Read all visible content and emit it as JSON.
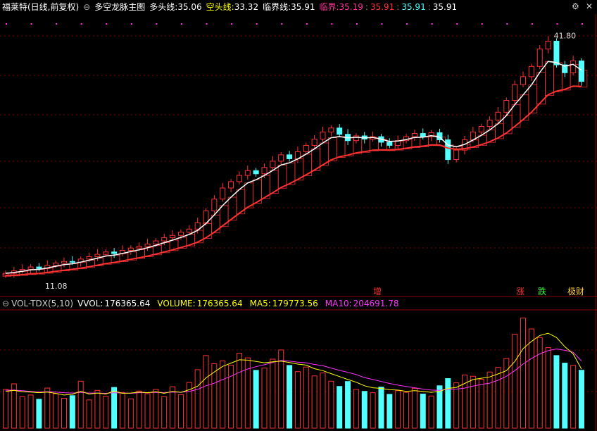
{
  "main_header": {
    "stock": "福莱特(日线,前复权)",
    "indicator_icon": "circle-minus-icon",
    "indicator": "多空龙脉主图",
    "bull_label": "多头线:",
    "bull_value": "35.06",
    "bear_label": "空头线:",
    "bear_value": "33.32",
    "crit_label": "临界线:",
    "crit_value": "35.91",
    "crit2_label": "临界:",
    "crit2_values": [
      "35.19",
      "35.91",
      "35.91",
      "35.91"
    ]
  },
  "vol_header": {
    "indicator_icon": "circle-minus-icon",
    "name": "VOL-TDX(5,10)",
    "vvol_label": "VVOL:",
    "vvol_value": "176365.64",
    "volume_label": "VOLUME:",
    "volume_value": "176365.64",
    "ma5_label": "MA5:",
    "ma5_value": "179773.56",
    "ma10_label": "MA10:",
    "ma10_value": "204691.78"
  },
  "window_controls": {
    "settings_icon": "gear-icon",
    "close_icon": "close-icon"
  },
  "colors": {
    "up": "#ff3232",
    "down": "#54ffff",
    "bull_line": "#ffffff",
    "bear_fill": "#ff3232",
    "yellow": "#ffff00",
    "magenta": "#ff33ff",
    "grid": "#7a0000"
  },
  "chart_data": [
    {
      "type": "candlestick",
      "title": "多空龙脉主图",
      "y_max_label": "41.80",
      "y_min_label": "11.08",
      "ylim": [
        10,
        43
      ],
      "annotations": [
        "增",
        "涨",
        "跌",
        "极财"
      ],
      "closes": [
        11.6,
        11.9,
        12.1,
        12.4,
        12.2,
        12.6,
        12.9,
        13.1,
        13.0,
        13.4,
        13.7,
        14.0,
        14.3,
        14.1,
        14.5,
        14.8,
        15.0,
        15.3,
        15.7,
        16.1,
        16.4,
        16.8,
        17.2,
        18.0,
        19.5,
        21.0,
        22.4,
        23.2,
        24.0,
        24.6,
        24.2,
        25.0,
        25.8,
        26.6,
        26.1,
        27.0,
        27.8,
        28.6,
        29.5,
        30.0,
        29.2,
        28.4,
        29.0,
        28.6,
        28.9,
        28.2,
        27.8,
        28.4,
        28.9,
        29.3,
        28.9,
        29.4,
        28.5,
        26.0,
        27.2,
        28.5,
        29.5,
        30.2,
        31.0,
        32.0,
        33.5,
        35.5,
        36.5,
        37.8,
        40.0,
        41.0,
        38.0,
        37.0,
        38.5,
        35.9
      ]
    },
    {
      "type": "bar",
      "title": "VOL-TDX(5,10)",
      "series": [
        {
          "name": "VOLUME",
          "values": [
            118000,
            135000,
            96000,
            101000,
            88000,
            122000,
            105000,
            91000,
            99000,
            143000,
            86000,
            115000,
            97000,
            124000,
            108000,
            89000,
            113000,
            105000,
            118000,
            96000,
            126000,
            102000,
            139000,
            178000,
            221000,
            196000,
            205000,
            192000,
            228000,
            214000,
            176000,
            183000,
            210000,
            238000,
            191000,
            172000,
            186000,
            159000,
            168000,
            143000,
            127000,
            142000,
            118000,
            112000,
            108000,
            125000,
            103000,
            114000,
            109000,
            121000,
            104000,
            98000,
            129000,
            151000,
            138000,
            162000,
            158000,
            149000,
            171000,
            185000,
            212000,
            286000,
            335000,
            302000,
            276000,
            245000,
            221000,
            198000,
            191000,
            176366
          ]
        },
        {
          "name": "MA5",
          "values": [
            112000,
            115000,
            111000,
            110000,
            108000,
            110000,
            106000,
            101000,
            103000,
            112000,
            104000,
            107000,
            104000,
            113000,
            106000,
            107000,
            110000,
            108000,
            111000,
            106000,
            112000,
            109000,
            117000,
            128000,
            153000,
            171000,
            188000,
            198000,
            208000,
            207000,
            203000,
            199000,
            202000,
            204000,
            200000,
            195000,
            192000,
            181000,
            175000,
            166000,
            157000,
            148000,
            140000,
            129000,
            123000,
            121000,
            117000,
            116000,
            112000,
            114000,
            112000,
            109000,
            112000,
            121000,
            124000,
            136000,
            148000,
            152000,
            156000,
            165000,
            175000,
            203000,
            242000,
            264000,
            282000,
            289000,
            276000,
            248000,
            226000,
            179774
          ]
        },
        {
          "name": "MA10",
          "values": [
            115000,
            116000,
            114000,
            112000,
            110000,
            111000,
            110000,
            108000,
            107000,
            109000,
            107000,
            107000,
            106000,
            108000,
            107000,
            106000,
            108000,
            108000,
            109000,
            108000,
            110000,
            109000,
            112000,
            118000,
            129000,
            137000,
            148000,
            158000,
            170000,
            180000,
            187000,
            193000,
            200000,
            206000,
            204000,
            201000,
            199000,
            194000,
            190000,
            183000,
            176000,
            170000,
            163000,
            154000,
            148000,
            142000,
            136000,
            131000,
            127000,
            123000,
            119000,
            116000,
            115000,
            118000,
            119000,
            122000,
            128000,
            133000,
            137000,
            146000,
            158000,
            175000,
            195000,
            212000,
            226000,
            236000,
            241000,
            237000,
            231000,
            204692
          ]
        }
      ],
      "ylim": [
        0,
        360000
      ]
    }
  ]
}
